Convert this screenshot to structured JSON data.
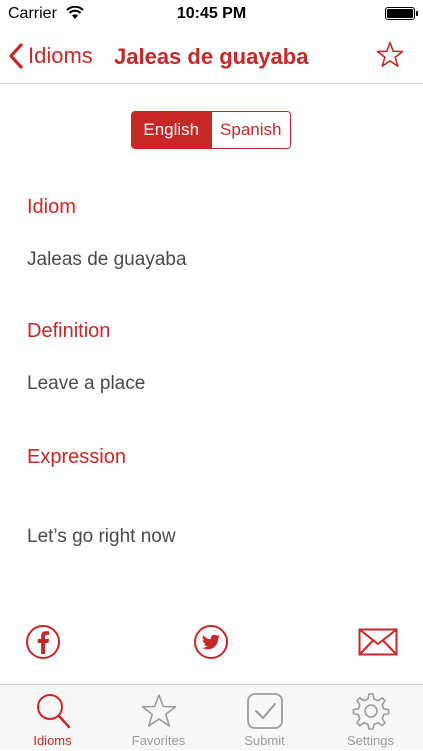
{
  "status": {
    "carrier": "Carrier",
    "time": "10:45 PM"
  },
  "nav": {
    "back_label": "Idioms",
    "title": "Jaleas de guayaba"
  },
  "language_toggle": {
    "options": [
      "English",
      "Spanish"
    ],
    "selected": "English"
  },
  "sections": [
    {
      "title": "Idiom",
      "text": "Jaleas de guayaba"
    },
    {
      "title": "Definition",
      "text": "Leave a place"
    },
    {
      "title": "Expression",
      "text": "Let’s go right now"
    }
  ],
  "share": {
    "icons": [
      "facebook-icon",
      "twitter-icon",
      "email-icon"
    ]
  },
  "tabs": [
    {
      "label": "Idioms",
      "icon": "search-icon",
      "active": true
    },
    {
      "label": "Favorites",
      "icon": "star-icon",
      "active": false
    },
    {
      "label": "Submit",
      "icon": "checkbox-icon",
      "active": false
    },
    {
      "label": "Settings",
      "icon": "gear-icon",
      "active": false
    }
  ],
  "colors": {
    "accent": "#c62828",
    "inactive_tab": "#9b9b9b",
    "text": "#4a4a4a"
  }
}
